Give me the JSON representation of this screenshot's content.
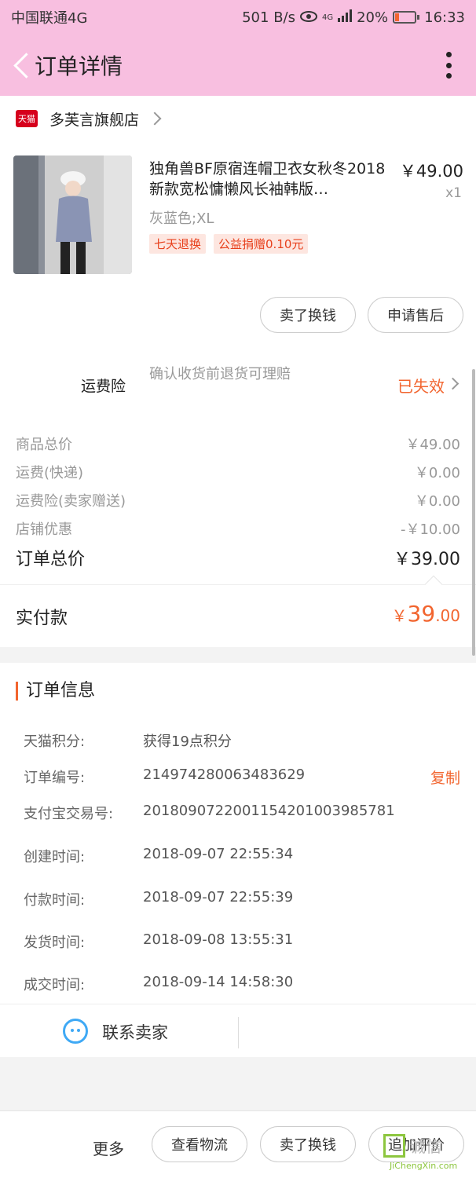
{
  "status_bar": {
    "carrier": "中国联通4G",
    "speed": "501 B/s",
    "network": "4G",
    "battery": "20%",
    "battery_level_percent": 20,
    "time": "16:33"
  },
  "header": {
    "title": "订单详情"
  },
  "store": {
    "badge": "天猫",
    "name": "多芙言旗舰店"
  },
  "product": {
    "title": "独角兽BF原宿连帽卫衣女秋冬2018新款宽松慵懒风长袖韩版…",
    "price": "￥49.00",
    "quantity": "x1",
    "spec": "灰蓝色;XL",
    "tags": [
      "七天退换",
      "公益捐赠0.10元"
    ],
    "buttons": {
      "resell": "卖了换钱",
      "after_sale": "申请售后"
    }
  },
  "shipping_insurance": {
    "label": "运费险",
    "description": "确认收货前退货可理赔",
    "status": "已失效"
  },
  "summary": {
    "rows": [
      {
        "label": "商品总价",
        "value": "￥49.00"
      },
      {
        "label": "运费(快递)",
        "value": "￥0.00"
      },
      {
        "label": "运费险(卖家赠送)",
        "value": "￥0.00"
      },
      {
        "label": "店铺优惠",
        "value": "-￥10.00"
      }
    ],
    "total_label": "订单总价",
    "total_value": "￥39.00"
  },
  "payment": {
    "label": "实付款",
    "currency": "￥",
    "integer": "39",
    "decimal": ".00"
  },
  "order_info": {
    "title": "订单信息",
    "points_label": "天猫积分:",
    "points_value": "获得19点积分",
    "order_no_label": "订单编号:",
    "order_no_value": "214974280063483629",
    "copy_label": "复制",
    "alipay_label": "支付宝交易号:",
    "alipay_value": "2018090722001154201003985781",
    "created_label": "创建时间:",
    "created_value": "2018-09-07 22:55:34",
    "paid_label": "付款时间:",
    "paid_value": "2018-09-07 22:55:39",
    "shipped_label": "发货时间:",
    "shipped_value": "2018-09-08 13:55:31",
    "completed_label": "成交时间:",
    "completed_value": "2018-09-14 14:58:30"
  },
  "contact": {
    "label": "联系卖家"
  },
  "bottom_bar": {
    "more": "更多",
    "logistics": "查看物流",
    "resell": "卖了换钱",
    "review": "追加评价"
  },
  "watermark": {
    "text": "诚信",
    "url": "JiChengXin.com"
  },
  "colors": {
    "header_bg": "#f8bfe0",
    "accent": "#f2652f",
    "tmall_red": "#d6001c",
    "contact_blue": "#3fa9f5"
  }
}
